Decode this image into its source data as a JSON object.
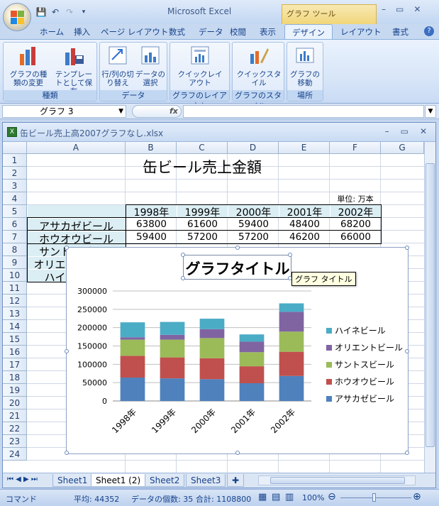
{
  "app": {
    "title": "Microsoft Excel",
    "context_tab_group": "グラフ ツール",
    "window_controls": [
      "–",
      "▭",
      "✕"
    ]
  },
  "ribbon": {
    "tabs": [
      "ホーム",
      "挿入",
      "ページ レイアウト",
      "数式",
      "データ",
      "校閲",
      "表示",
      "デザイン",
      "レイアウト",
      "書式"
    ],
    "active_tab": "デザイン",
    "groups": [
      {
        "label": "種類",
        "buttons": [
          {
            "label": "グラフの種類の変更",
            "icon": "chart-type-icon"
          },
          {
            "label": "テンプレートとして保存",
            "icon": "save-template-icon"
          }
        ]
      },
      {
        "label": "データ",
        "buttons": [
          {
            "label": "行/列の切り替え",
            "icon": "switch-row-col-icon"
          },
          {
            "label": "データの選択",
            "icon": "select-data-icon"
          }
        ]
      },
      {
        "label": "グラフのレイアウト",
        "buttons": [
          {
            "label": "クイックレイアウト",
            "icon": "quick-layout-icon"
          }
        ]
      },
      {
        "label": "グラフのスタイル",
        "buttons": [
          {
            "label": "クイックスタイル",
            "icon": "quick-style-icon"
          }
        ]
      },
      {
        "label": "場所",
        "buttons": [
          {
            "label": "グラフの移動",
            "icon": "move-chart-icon"
          }
        ]
      }
    ]
  },
  "formula_bar": {
    "name_box": "グラフ 3",
    "fx": "fx",
    "value": ""
  },
  "workbook": {
    "title": "缶ビール売上高2007グラフなし.xlsx",
    "columns": [
      "A",
      "B",
      "C",
      "D",
      "E",
      "F",
      "G"
    ],
    "rows": [
      "1",
      "2",
      "3",
      "4",
      "5",
      "6",
      "7",
      "8",
      "9",
      "10",
      "11",
      "12",
      "13",
      "14",
      "15",
      "16",
      "17",
      "18",
      "19",
      "20",
      "21",
      "22",
      "23",
      "24"
    ],
    "sheet_title": "缶ビール売上金額",
    "unit_label": "単位: 万本",
    "year_headers": [
      "1998年",
      "1999年",
      "2000年",
      "2001年",
      "2002年"
    ],
    "table_rows": [
      {
        "name": "アサカゼビール",
        "values": [
          "63800",
          "61600",
          "59400",
          "48400",
          "68200"
        ]
      },
      {
        "name": "ホウオウビール",
        "values": [
          "59400",
          "57200",
          "57200",
          "46200",
          "66000"
        ]
      },
      {
        "name": "サントスビール",
        "values": [
          "",
          "",
          "",
          "",
          ""
        ]
      },
      {
        "name": "オリエントビール",
        "values": [
          "",
          "",
          "",
          "",
          ""
        ]
      },
      {
        "name": "ハイネビール",
        "values": [
          "",
          "",
          "",
          "",
          ""
        ]
      }
    ],
    "sheet_tabs": [
      "Sheet1",
      "Sheet1 (2)",
      "Sheet2",
      "Sheet3"
    ],
    "active_sheet": "Sheet1 (2)"
  },
  "chart_data": {
    "type": "bar",
    "stacked": true,
    "title": "グラフタイトル",
    "categories": [
      "1998年",
      "1999年",
      "2000年",
      "2001年",
      "2002年"
    ],
    "ylim": [
      0,
      300000
    ],
    "yticks": [
      "300000",
      "250000",
      "200000",
      "150000",
      "100000",
      "50000",
      "0"
    ],
    "legend_position": "right",
    "series": [
      {
        "name": "アサカゼビール",
        "color": "#4f81bd",
        "values": [
          63800,
          61600,
          59400,
          48400,
          68200
        ]
      },
      {
        "name": "ホウオウビール",
        "color": "#c0504d",
        "values": [
          59400,
          57200,
          57200,
          46200,
          66000
        ]
      },
      {
        "name": "サントスビール",
        "color": "#9bbb59",
        "values": [
          44000,
          48400,
          55000,
          38500,
          55000
        ]
      },
      {
        "name": "オリエントビール",
        "color": "#8064a2",
        "values": [
          6600,
          13200,
          24200,
          28600,
          53900
        ]
      },
      {
        "name": "ハイネビール",
        "color": "#4bacc6",
        "values": [
          40700,
          35200,
          28600,
          19800,
          23100
        ]
      }
    ]
  },
  "tooltip": "グラフ タイトル",
  "status": {
    "mode": "コマンド",
    "average": "平均: 44352",
    "count": "データの個数: 35",
    "sum": "合計: 1108800",
    "zoom": "100%"
  }
}
